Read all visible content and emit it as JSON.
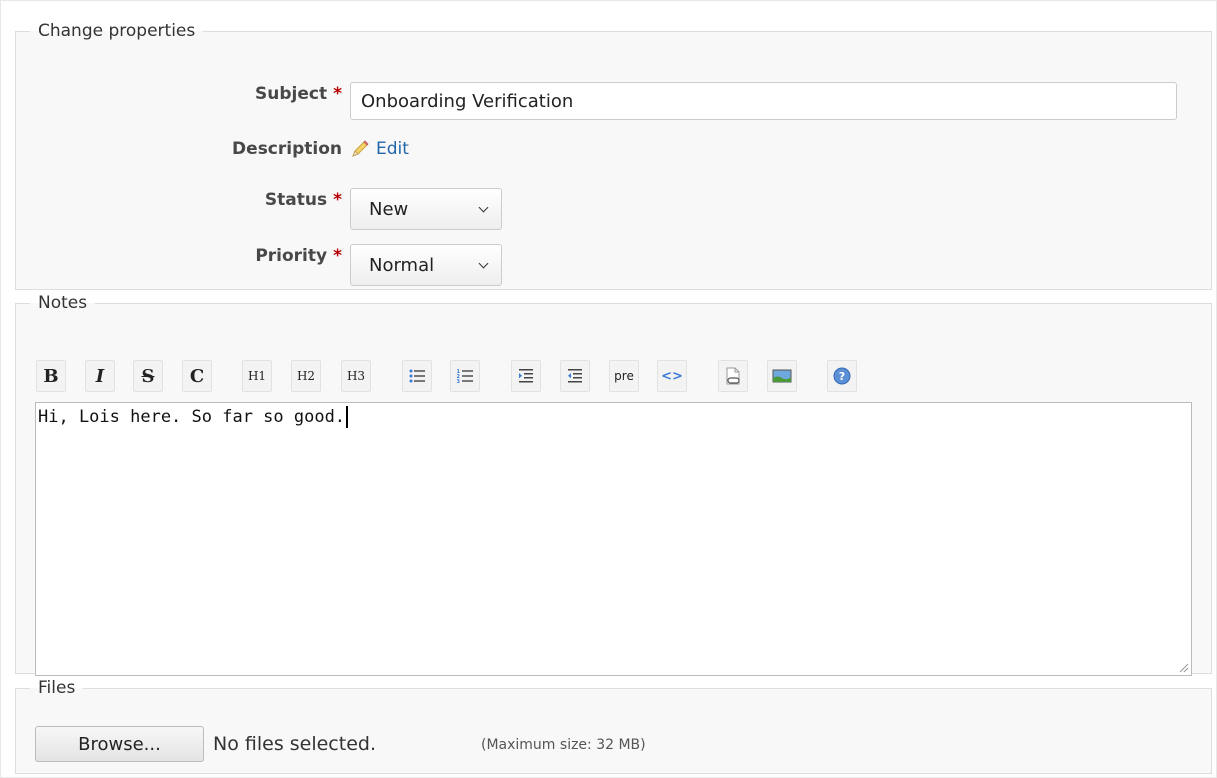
{
  "properties": {
    "legend": "Change properties",
    "subject": {
      "label": "Subject",
      "required": "*",
      "value": "Onboarding Verification"
    },
    "description": {
      "label": "Description",
      "edit_label": "Edit"
    },
    "status": {
      "label": "Status",
      "required": "*",
      "value": "New"
    },
    "priority": {
      "label": "Priority",
      "required": "*",
      "value": "Normal"
    }
  },
  "notes": {
    "legend": "Notes",
    "toolbar": [
      {
        "name": "bold-button",
        "glyph": "B"
      },
      {
        "name": "italic-button",
        "glyph": "I"
      },
      {
        "name": "strikethrough-button",
        "glyph": "S"
      },
      {
        "name": "code-inline-button",
        "glyph": "C"
      },
      {
        "name": "heading1-button",
        "glyph": "H1"
      },
      {
        "name": "heading2-button",
        "glyph": "H2"
      },
      {
        "name": "heading3-button",
        "glyph": "H3"
      },
      {
        "name": "unordered-list-button",
        "glyph": ""
      },
      {
        "name": "ordered-list-button",
        "glyph": ""
      },
      {
        "name": "indent-button",
        "glyph": ""
      },
      {
        "name": "outdent-button",
        "glyph": ""
      },
      {
        "name": "preformatted-button",
        "glyph": "pre"
      },
      {
        "name": "code-highlight-button",
        "glyph": "<>"
      },
      {
        "name": "link-button",
        "glyph": ""
      },
      {
        "name": "image-button",
        "glyph": ""
      },
      {
        "name": "help-button",
        "glyph": ""
      }
    ],
    "text": "Hi, Lois here. So far so good."
  },
  "files": {
    "legend": "Files",
    "browse_label": "Browse...",
    "status": "No files selected.",
    "max_size": "(Maximum size: 32 MB)"
  },
  "colors": {
    "required": "#bb0000",
    "link": "#2266aa",
    "fieldset_bg": "#f8f8f8"
  }
}
